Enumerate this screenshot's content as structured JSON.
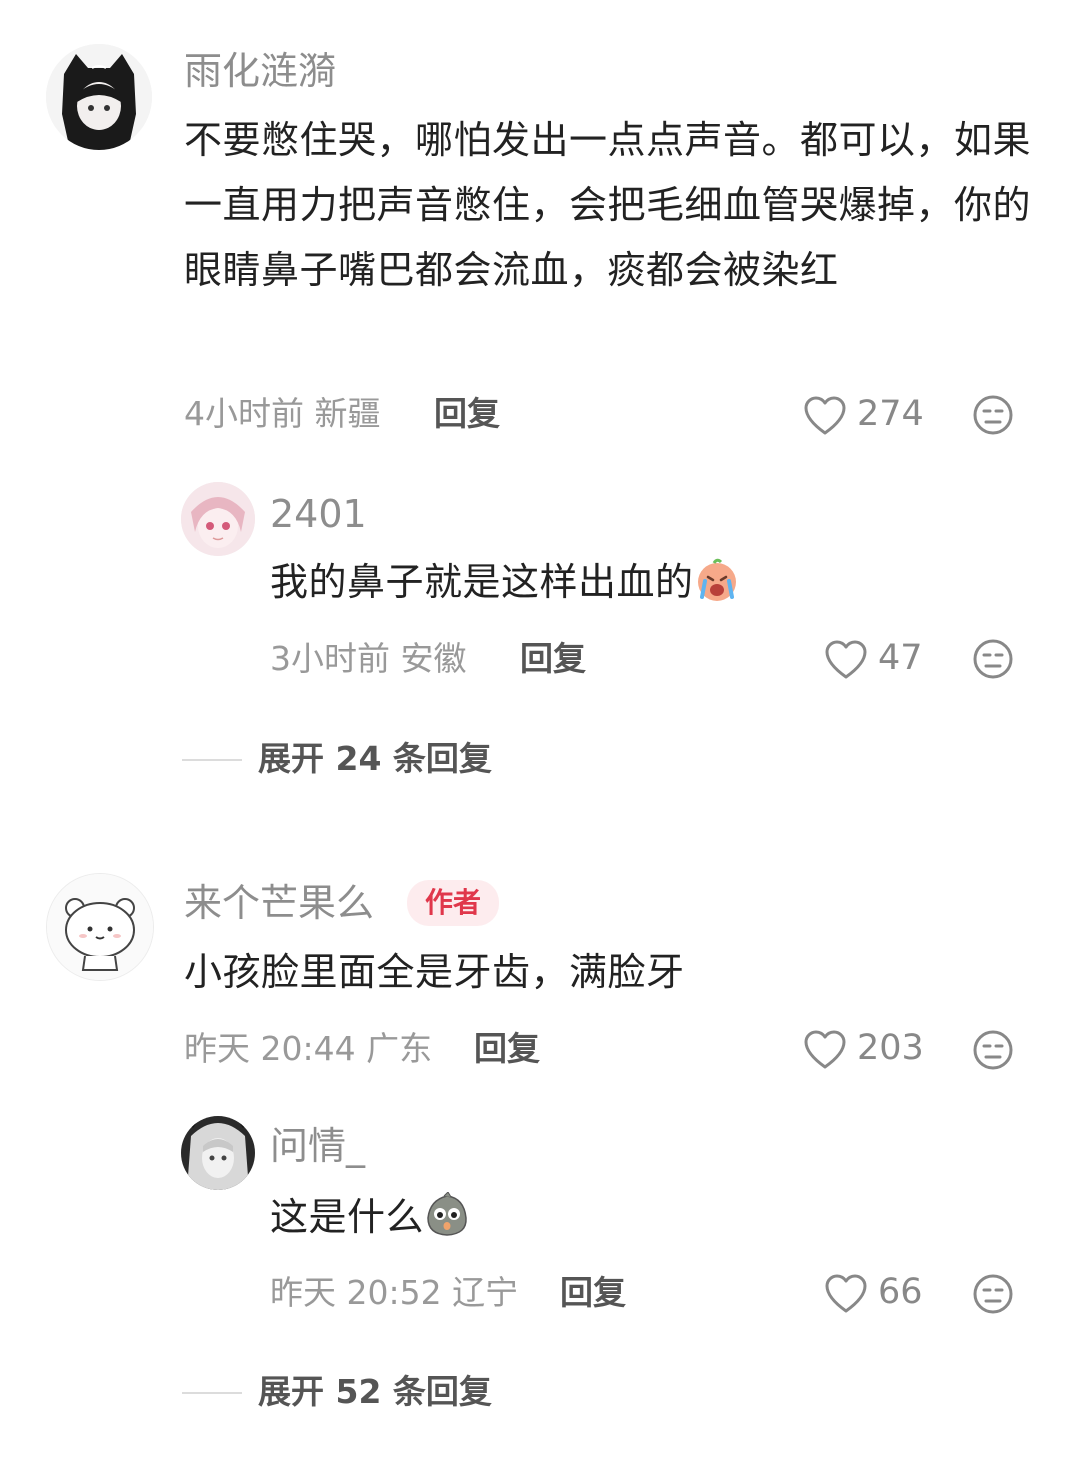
{
  "comments": [
    {
      "username": "雨化涟漪",
      "text": "不要憋住哭，哪怕发出一点点声音。都可以，如果一直用力把声音憋住，会把毛细血管哭爆掉，你的眼睛鼻子嘴巴都会流血，痰都会被染红",
      "time_location": "4小时前 新疆",
      "reply_label": "回复",
      "likes": "274",
      "is_author": false,
      "replies": [
        {
          "username": "2401",
          "text": "我的鼻子就是这样出血的",
          "emoji": "crying-face-emoji",
          "time_location": "3小时前 安徽",
          "reply_label": "回复",
          "likes": "47"
        }
      ],
      "expand_label": "展开 24 条回复"
    },
    {
      "username": "来个芒果么",
      "author_badge": "作者",
      "text": "小孩脸里面全是牙齿，满脸牙",
      "time_location": "昨天 20:44 广东",
      "reply_label": "回复",
      "likes": "203",
      "is_author": true,
      "replies": [
        {
          "username": "问情_",
          "text": "这是什么",
          "emoji": "shocked-bean-emoji",
          "time_location": "昨天 20:52 辽宁",
          "reply_label": "回复",
          "likes": "66"
        }
      ],
      "expand_label": "展开 52 条回复"
    }
  ],
  "colors": {
    "author_badge_bg": "#fdecee",
    "author_badge_text": "#e0374b",
    "muted_text": "#999999"
  }
}
